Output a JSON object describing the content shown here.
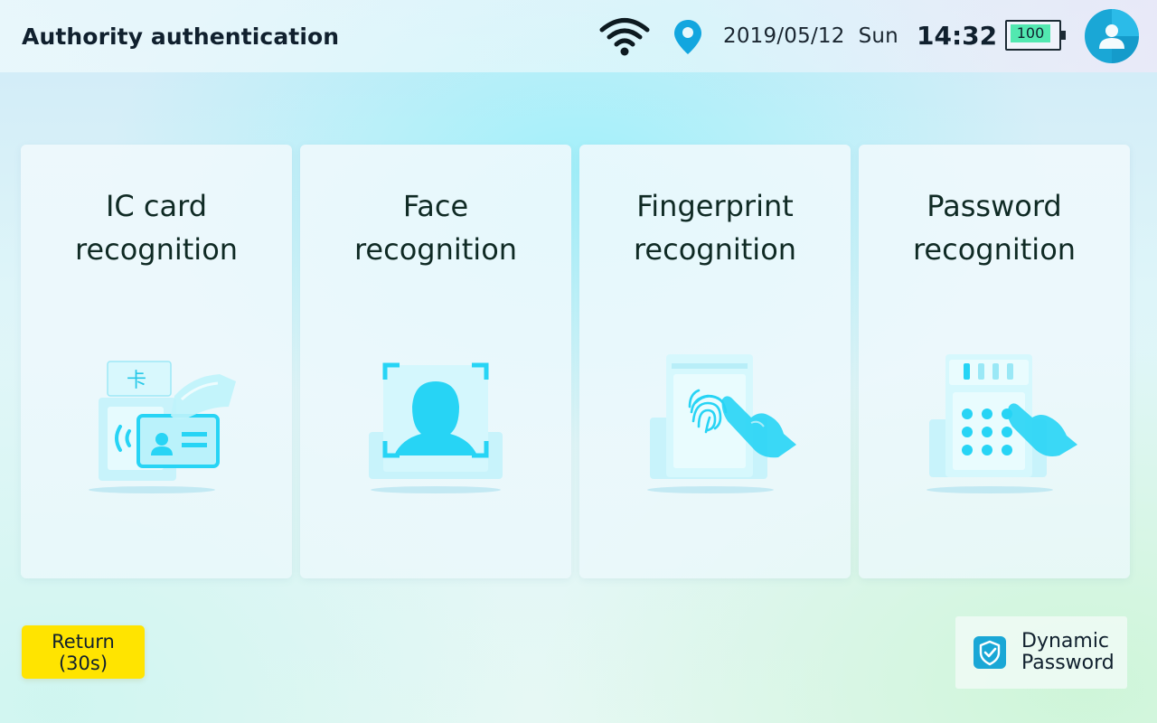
{
  "header": {
    "title": "Authority authentication",
    "date": "2019/05/12",
    "weekday": "Sun",
    "time": "14:32",
    "battery_level": "100",
    "icons": [
      "wifi-icon",
      "location-icon",
      "battery-icon",
      "user-avatar-icon"
    ]
  },
  "methods": [
    {
      "line1": "IC card",
      "line2": "recognition",
      "icon": "ic-card-icon",
      "card_glyph": "卡"
    },
    {
      "line1": "Face",
      "line2": "recognition",
      "icon": "face-icon"
    },
    {
      "line1": "Fingerprint",
      "line2": "recognition",
      "icon": "fingerprint-icon"
    },
    {
      "line1": "Password",
      "line2": "recognition",
      "icon": "keypad-icon"
    }
  ],
  "footer": {
    "return_label": "Return",
    "return_countdown": "(30s)",
    "dynamic_line1": "Dynamic",
    "dynamic_line2": "Password"
  },
  "colors": {
    "accent": "#1aa7d6",
    "icon_cyan": "#27d4f5",
    "return_button": "#ffe400",
    "battery_fill": "#52e8b0",
    "text": "#10202e"
  }
}
